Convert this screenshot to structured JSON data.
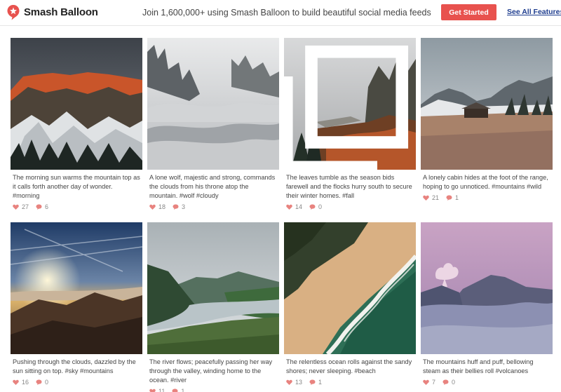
{
  "header": {
    "brand": "Smash Balloon",
    "tagline": "Join 1,600,000+ using Smash Balloon to build beautiful social media feeds",
    "cta_label": "Get Started",
    "features_link": "See All Features",
    "accent_color": "#e8524e",
    "link_color": "#1e3d8f"
  },
  "posts": [
    {
      "caption": "The morning sun warms the mountain top as it calls forth another day of wonder. #morning",
      "likes": "27",
      "comments": "6",
      "photo": "mountain-sunrise-snow",
      "multi_image": false
    },
    {
      "caption": "A lone wolf, majestic and strong, commands the clouds from his throne atop the mountain. #wolf #cloudy",
      "likes": "18",
      "comments": "3",
      "photo": "foggy-forest-clouds",
      "multi_image": false
    },
    {
      "caption": "The leaves tumble as the season bids farewell and the flocks hurry south to secure their winter homes. #fall",
      "likes": "14",
      "comments": "0",
      "photo": "autumn-forest-fog",
      "multi_image": true
    },
    {
      "caption": "A lonely cabin hides at the foot of the range, hoping to go unnoticed. #mountains #wild",
      "likes": "21",
      "comments": "1",
      "photo": "cabin-meadow-mountains",
      "multi_image": false
    },
    {
      "caption": "Pushing through the clouds, dazzled by the sun sitting on top. #sky #mountains",
      "likes": "16",
      "comments": "0",
      "photo": "sunset-above-clouds",
      "multi_image": false
    },
    {
      "caption": "The river flows; peacefully passing her way through the valley, winding home to the ocean. #river",
      "likes": "11",
      "comments": "1",
      "photo": "river-valley",
      "multi_image": false
    },
    {
      "caption": "The relentless ocean rolls against the sandy shores; never sleeping. #beach",
      "likes": "13",
      "comments": "1",
      "photo": "aerial-beach",
      "multi_image": false
    },
    {
      "caption": "The mountains huff and puff, bellowing steam as their bellies roll #volcanoes",
      "likes": "7",
      "comments": "0",
      "photo": "volcano-pink-sky",
      "multi_image": false
    }
  ]
}
